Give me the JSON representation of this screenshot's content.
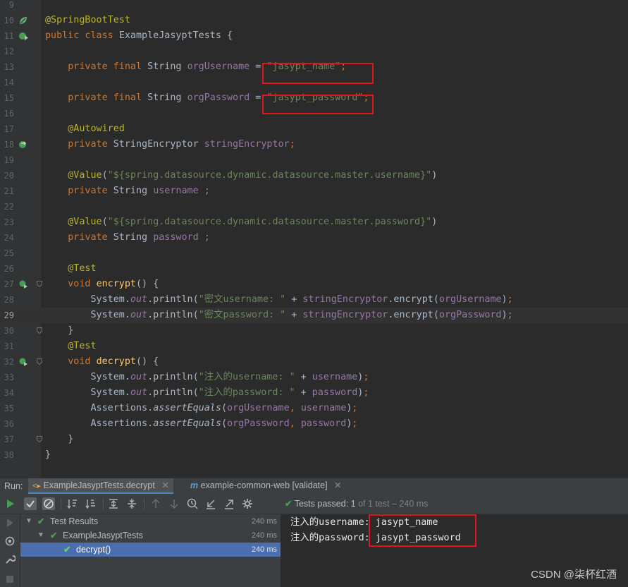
{
  "editor": {
    "current_line": "29",
    "lines": [
      {
        "n": "9",
        "t": []
      },
      {
        "n": "10",
        "icon": "spring-bean",
        "t": [
          [
            "a",
            "@SpringBootTest"
          ]
        ]
      },
      {
        "n": "11",
        "icon": "run-class",
        "t": [
          [
            "k",
            "public class "
          ],
          [
            "p",
            "ExampleJasyptTests {"
          ]
        ]
      },
      {
        "n": "12",
        "t": []
      },
      {
        "n": "13",
        "t": [
          [
            "p",
            "    "
          ],
          [
            "k",
            "private final "
          ],
          [
            "p",
            "String "
          ],
          [
            "f",
            "orgUsername"
          ],
          [
            "p",
            " = "
          ],
          [
            "s",
            "\"jasypt_name\""
          ],
          [
            "k",
            ";"
          ]
        ]
      },
      {
        "n": "14",
        "t": []
      },
      {
        "n": "15",
        "t": [
          [
            "p",
            "    "
          ],
          [
            "k",
            "private final "
          ],
          [
            "p",
            "String "
          ],
          [
            "f",
            "orgPassword"
          ],
          [
            "p",
            " = "
          ],
          [
            "s",
            "\"jasypt_password\""
          ],
          [
            "k",
            ";"
          ]
        ]
      },
      {
        "n": "16",
        "t": []
      },
      {
        "n": "17",
        "t": [
          [
            "p",
            "    "
          ],
          [
            "a",
            "@Autowired"
          ]
        ]
      },
      {
        "n": "18",
        "icon": "autowired",
        "t": [
          [
            "p",
            "    "
          ],
          [
            "k",
            "private "
          ],
          [
            "p",
            "StringEncryptor "
          ],
          [
            "f",
            "stringEncryptor"
          ],
          [
            "k",
            ";"
          ]
        ]
      },
      {
        "n": "19",
        "t": []
      },
      {
        "n": "20",
        "t": [
          [
            "p",
            "    "
          ],
          [
            "a",
            "@Value"
          ],
          [
            "p",
            "("
          ],
          [
            "s",
            "\"${spring.datasource.dynamic.datasource.master.username}\""
          ],
          [
            "p",
            ")"
          ]
        ]
      },
      {
        "n": "21",
        "t": [
          [
            "p",
            "    "
          ],
          [
            "k",
            "private "
          ],
          [
            "p",
            "String "
          ],
          [
            "f",
            "username "
          ],
          [
            "k",
            ";"
          ]
        ]
      },
      {
        "n": "22",
        "t": []
      },
      {
        "n": "23",
        "t": [
          [
            "p",
            "    "
          ],
          [
            "a",
            "@Value"
          ],
          [
            "p",
            "("
          ],
          [
            "s",
            "\"${spring.datasource.dynamic.datasource.master.password}\""
          ],
          [
            "p",
            ")"
          ]
        ]
      },
      {
        "n": "24",
        "t": [
          [
            "p",
            "    "
          ],
          [
            "k",
            "private "
          ],
          [
            "p",
            "String "
          ],
          [
            "f",
            "password "
          ],
          [
            "k",
            ";"
          ]
        ]
      },
      {
        "n": "25",
        "t": []
      },
      {
        "n": "26",
        "t": [
          [
            "p",
            "    "
          ],
          [
            "a",
            "@Test"
          ]
        ]
      },
      {
        "n": "27",
        "icon": "run-method",
        "fold": true,
        "t": [
          [
            "p",
            "    "
          ],
          [
            "k",
            "void "
          ],
          [
            "m",
            "encrypt"
          ],
          [
            "p",
            "() {"
          ]
        ]
      },
      {
        "n": "28",
        "t": [
          [
            "p",
            "        System."
          ],
          [
            "i",
            "out"
          ],
          [
            "p",
            ".println("
          ],
          [
            "s",
            "\"密文username: \""
          ],
          [
            "p",
            " + "
          ],
          [
            "f",
            "stringEncryptor"
          ],
          [
            "p",
            ".encrypt("
          ],
          [
            "f",
            "orgUsername"
          ],
          [
            "p",
            ")"
          ],
          [
            "k",
            ";"
          ]
        ]
      },
      {
        "n": "29",
        "t": [
          [
            "p",
            "        System."
          ],
          [
            "i",
            "out"
          ],
          [
            "p",
            ".println("
          ],
          [
            "s",
            "\"密文password: \""
          ],
          [
            "p",
            " + "
          ],
          [
            "f",
            "stringEncryptor"
          ],
          [
            "p",
            ".encrypt("
          ],
          [
            "f",
            "orgPassword"
          ],
          [
            "p",
            ")"
          ],
          [
            "k",
            ";"
          ]
        ]
      },
      {
        "n": "30",
        "fold": true,
        "t": [
          [
            "p",
            "    }"
          ]
        ]
      },
      {
        "n": "31",
        "t": [
          [
            "p",
            "    "
          ],
          [
            "a",
            "@Test"
          ]
        ]
      },
      {
        "n": "32",
        "icon": "run-method",
        "fold": true,
        "t": [
          [
            "p",
            "    "
          ],
          [
            "k",
            "void "
          ],
          [
            "m",
            "decrypt"
          ],
          [
            "p",
            "() {"
          ]
        ]
      },
      {
        "n": "33",
        "t": [
          [
            "p",
            "        System."
          ],
          [
            "i",
            "out"
          ],
          [
            "p",
            ".println("
          ],
          [
            "s",
            "\"注入的username: \""
          ],
          [
            "p",
            " + "
          ],
          [
            "f",
            "username"
          ],
          [
            "p",
            ")"
          ],
          [
            "k",
            ";"
          ]
        ]
      },
      {
        "n": "34",
        "t": [
          [
            "p",
            "        System."
          ],
          [
            "i",
            "out"
          ],
          [
            "p",
            ".println("
          ],
          [
            "s",
            "\"注入的password: \""
          ],
          [
            "p",
            " + "
          ],
          [
            "f",
            "password"
          ],
          [
            "p",
            ")"
          ],
          [
            "k",
            ";"
          ]
        ]
      },
      {
        "n": "35",
        "t": [
          [
            "p",
            "        Assertions."
          ],
          [
            "st",
            "assertEquals"
          ],
          [
            "p",
            "("
          ],
          [
            "f",
            "orgUsername"
          ],
          [
            "k",
            ", "
          ],
          [
            "f",
            "username"
          ],
          [
            "p",
            ")"
          ],
          [
            "k",
            ";"
          ]
        ]
      },
      {
        "n": "36",
        "t": [
          [
            "p",
            "        Assertions."
          ],
          [
            "st",
            "assertEquals"
          ],
          [
            "p",
            "("
          ],
          [
            "f",
            "orgPassword"
          ],
          [
            "k",
            ", "
          ],
          [
            "f",
            "password"
          ],
          [
            "p",
            ")"
          ],
          [
            "k",
            ";"
          ]
        ]
      },
      {
        "n": "37",
        "fold": true,
        "t": [
          [
            "p",
            "    }"
          ]
        ]
      },
      {
        "n": "38",
        "t": [
          [
            "p",
            "}"
          ]
        ]
      }
    ]
  },
  "run": {
    "label": "Run:",
    "tabs": [
      {
        "label": "ExampleJasyptTests.decrypt",
        "icon": "test-config-icon"
      },
      {
        "label": "example-common-web [validate]",
        "icon": "maven-icon"
      }
    ],
    "status_prefix": "Tests passed: ",
    "status_count": "1",
    "status_suffix": " of 1 test – 240 ms"
  },
  "tree": [
    {
      "label": "Test Results",
      "ms": "240 ms",
      "level": 0
    },
    {
      "label": "ExampleJasyptTests",
      "ms": "240 ms",
      "level": 1
    },
    {
      "label": "decrypt()",
      "ms": "240 ms",
      "level": 2,
      "selected": true
    }
  ],
  "console": [
    {
      "prefix": "注入的username: ",
      "value": "jasypt_name"
    },
    {
      "prefix": "注入的password: ",
      "value": "jasypt_password"
    }
  ],
  "watermark": "CSDN @柒杯红酒",
  "colors": {
    "highlight_box": "#e0161b",
    "pass_green": "#499c54",
    "selection": "#4b6eaf"
  }
}
